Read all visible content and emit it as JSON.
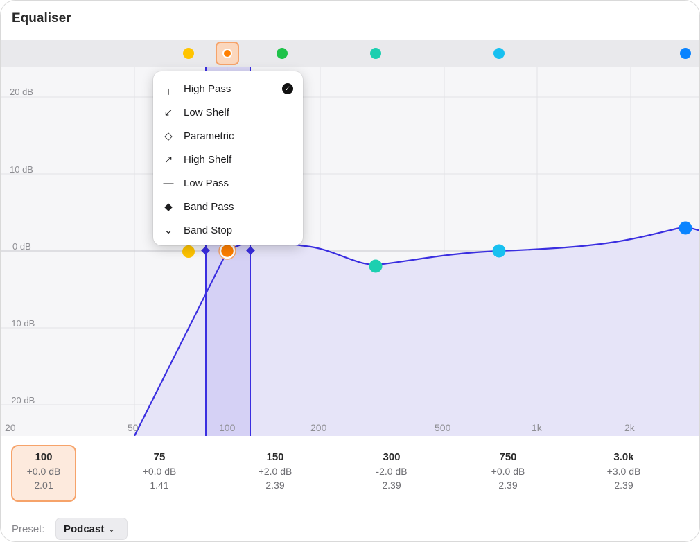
{
  "window": {
    "title": "Equaliser"
  },
  "colors": {
    "accent": "#3a2ee0",
    "fill": "#e6e4f8",
    "selected_band": "#ff7f00",
    "selected_bg": "#fdeadd",
    "selected_border": "#f6a36a"
  },
  "band_strip": [
    {
      "band": "75",
      "color": "#ffc400",
      "selected": false
    },
    {
      "band": "100",
      "color": "#ff7f00",
      "selected": true
    },
    {
      "band": "150",
      "color": "#1fc24a",
      "selected": false
    },
    {
      "band": "300",
      "color": "#1ccfb0",
      "selected": false
    },
    {
      "band": "750",
      "color": "#18c0f0",
      "selected": false
    },
    {
      "band": "3.0k",
      "color": "#0a84ff",
      "selected": false
    }
  ],
  "graph": {
    "y_labels": [
      "20 dB",
      "10 dB",
      "0 dB",
      "-10 dB",
      "-20 dB"
    ],
    "x_labels": [
      "20",
      "50",
      "100",
      "200",
      "500",
      "1k",
      "2k"
    ]
  },
  "filter_menu": {
    "items": [
      {
        "label": "High Pass",
        "icon": "high-pass-icon",
        "glyph": "╷",
        "checked": true
      },
      {
        "label": "Low Shelf",
        "icon": "low-shelf-icon",
        "glyph": "↙",
        "checked": false
      },
      {
        "label": "Parametric",
        "icon": "parametric-icon",
        "glyph": "◇",
        "checked": false
      },
      {
        "label": "High Shelf",
        "icon": "high-shelf-icon",
        "glyph": "↗",
        "checked": false
      },
      {
        "label": "Low Pass",
        "icon": "low-pass-icon",
        "glyph": "—",
        "checked": false
      },
      {
        "label": "Band Pass",
        "icon": "band-pass-icon",
        "glyph": "◆",
        "checked": false
      },
      {
        "label": "Band Stop",
        "icon": "band-stop-icon",
        "glyph": "⌄",
        "checked": false
      }
    ],
    "check_glyph": "✓"
  },
  "bands": [
    {
      "freq": "100",
      "gain": "+0.0 dB",
      "q": "2.01",
      "selected": true
    },
    {
      "freq": "75",
      "gain": "+0.0 dB",
      "q": "1.41",
      "selected": false
    },
    {
      "freq": "150",
      "gain": "+2.0 dB",
      "q": "2.39",
      "selected": false
    },
    {
      "freq": "300",
      "gain": "-2.0 dB",
      "q": "2.39",
      "selected": false
    },
    {
      "freq": "750",
      "gain": "+0.0 dB",
      "q": "2.39",
      "selected": false
    },
    {
      "freq": "3.0k",
      "gain": "+3.0 dB",
      "q": "2.39",
      "selected": false
    }
  ],
  "footer": {
    "preset_label": "Preset:",
    "preset_value": "Podcast",
    "chevron": "⌄"
  }
}
